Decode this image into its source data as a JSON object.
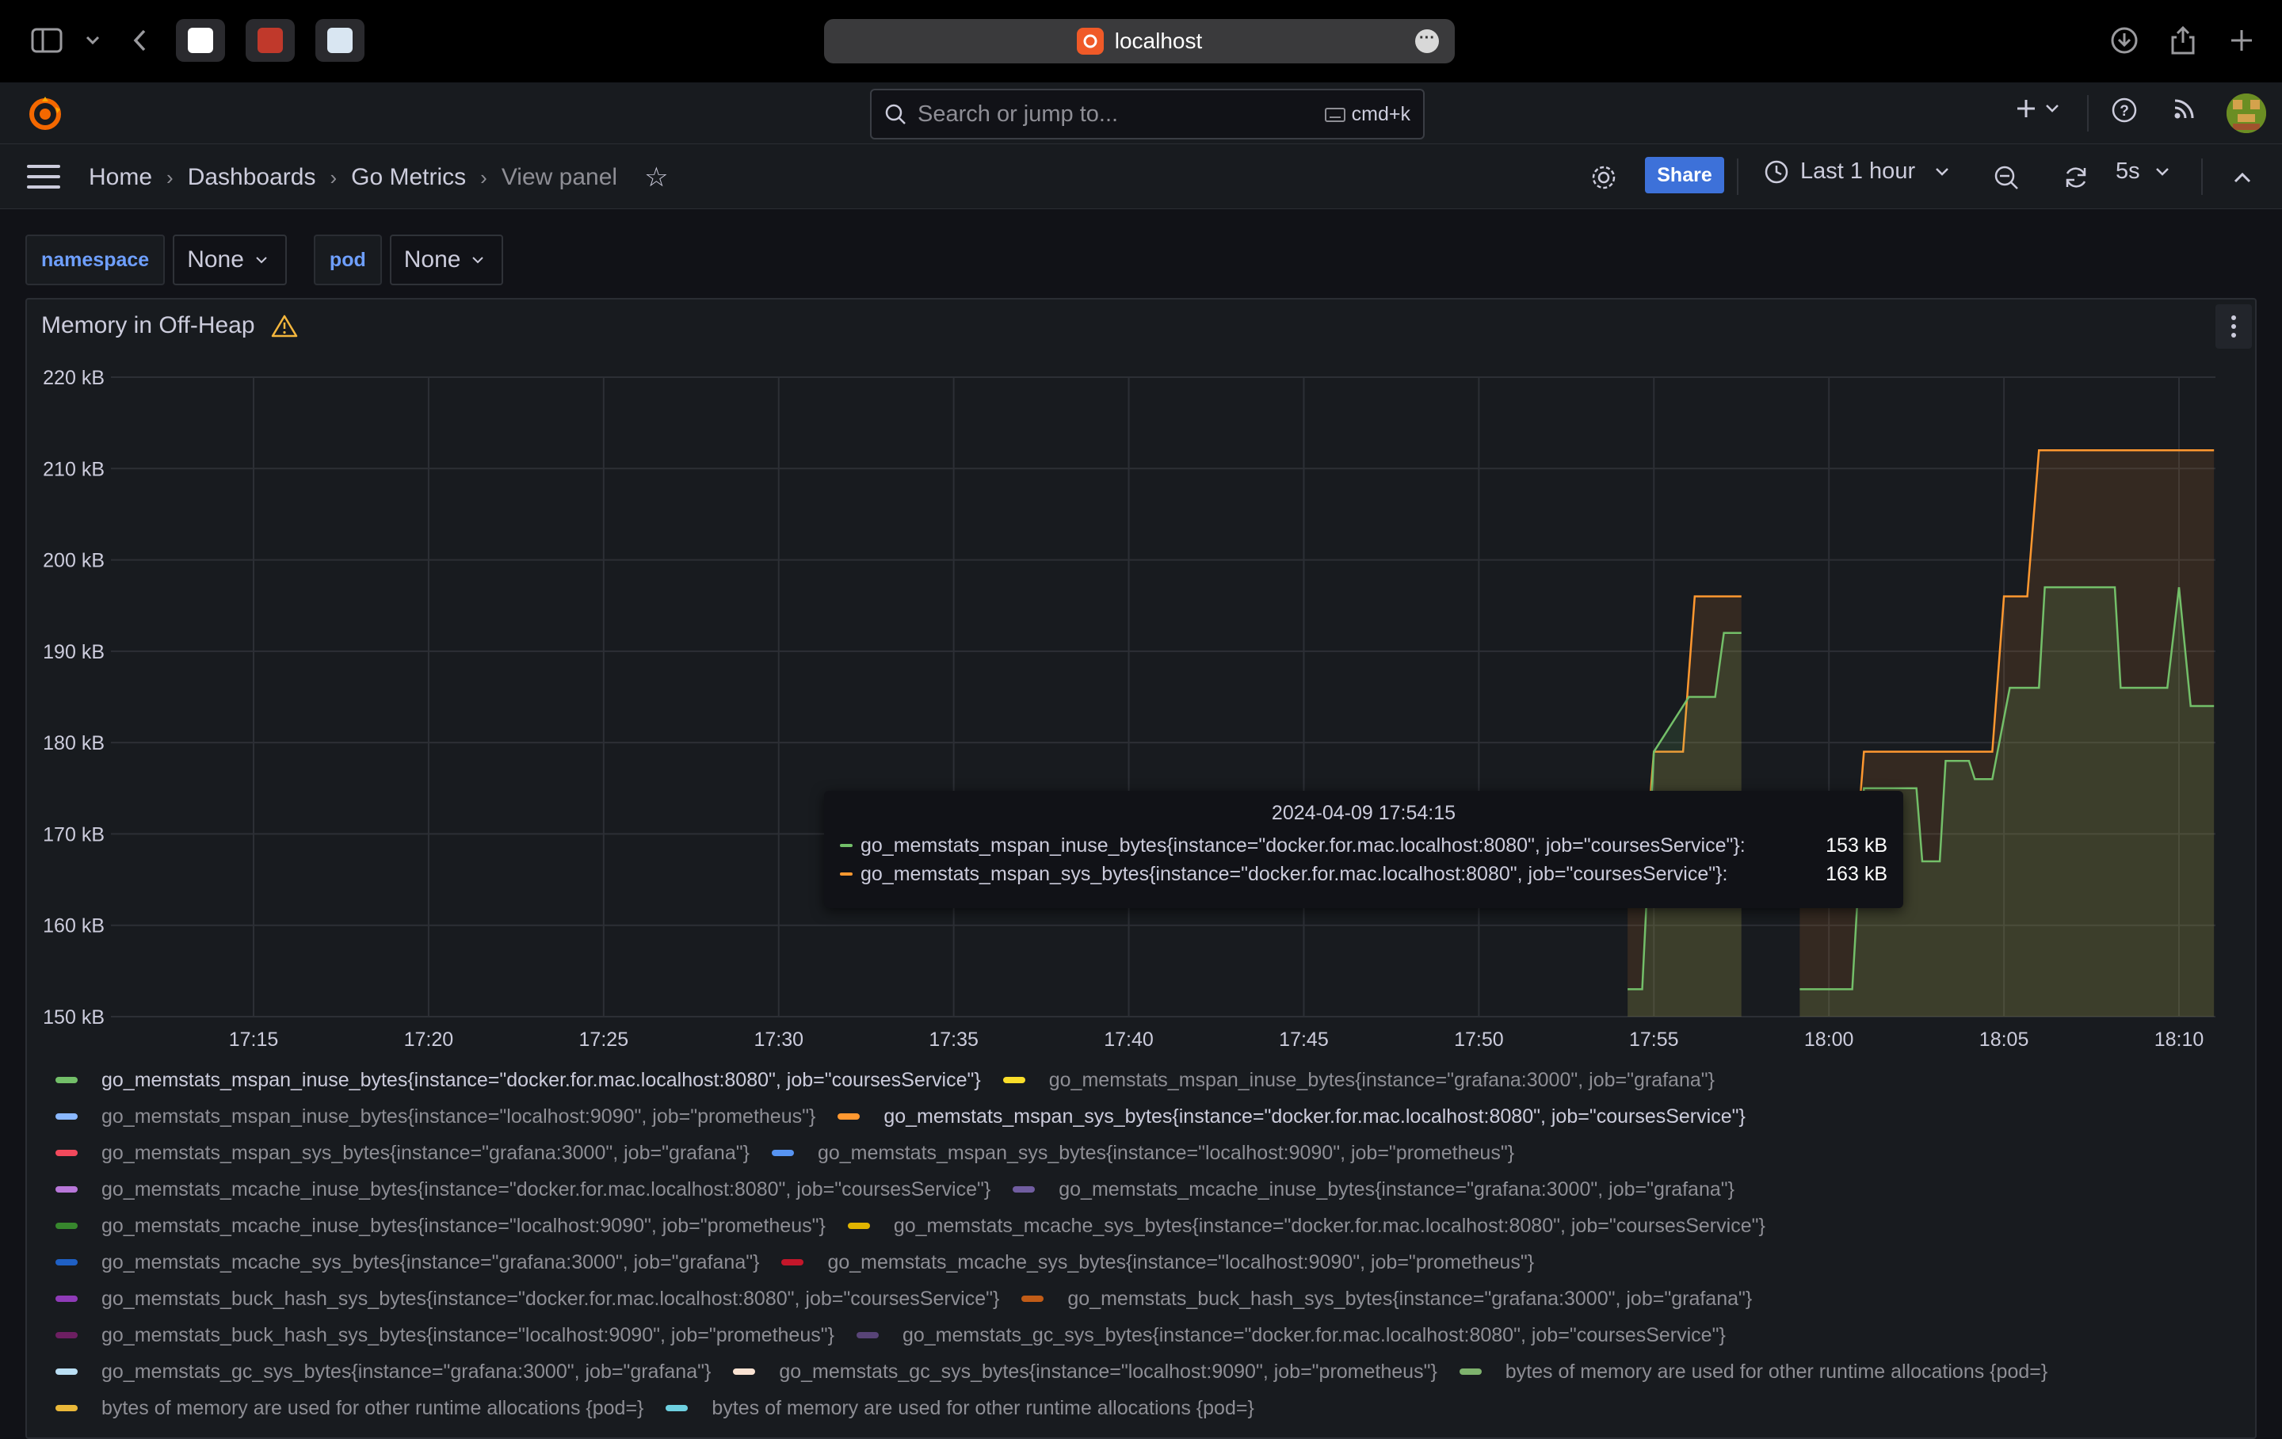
{
  "browser": {
    "url": "localhost"
  },
  "nav": {
    "search_placeholder": "Search or jump to...",
    "shortcut": "cmd+k"
  },
  "breadcrumbs": {
    "home": "Home",
    "dashboards": "Dashboards",
    "dashboard": "Go Metrics",
    "current": "View panel"
  },
  "toolbar": {
    "share": "Share",
    "time_range": "Last 1 hour",
    "refresh_interval": "5s"
  },
  "variables": [
    {
      "label": "namespace",
      "value": "None"
    },
    {
      "label": "pod",
      "value": "None"
    }
  ],
  "panel": {
    "title": "Memory in Off-Heap"
  },
  "chart_data": {
    "type": "line",
    "title": "Memory in Off-Heap",
    "y_ticks": [
      "220 kB",
      "210 kB",
      "200 kB",
      "190 kB",
      "180 kB",
      "170 kB",
      "160 kB",
      "150 kB"
    ],
    "ylim": [
      150,
      220
    ],
    "y_unit": "kB",
    "x_ticks": [
      "17:15",
      "17:20",
      "17:25",
      "17:30",
      "17:35",
      "17:40",
      "17:45",
      "17:50",
      "17:55",
      "18:00",
      "18:05",
      "18:10"
    ],
    "grid": true,
    "series": [
      {
        "name": "go_memstats_mspan_inuse_bytes{instance=\"docker.for.mac.localhost:8080\", job=\"coursesService\"}",
        "color": "#73bf69",
        "segments": [
          [
            [
              "17:54:15",
              153
            ],
            [
              "17:54:40",
              153
            ],
            [
              "17:55:00",
              179
            ],
            [
              "17:56:00",
              185
            ],
            [
              "17:56:45",
              185
            ],
            [
              "17:57:00",
              192
            ],
            [
              "17:57:30",
              192
            ]
          ],
          [
            [
              "17:59:10",
              153
            ],
            [
              "18:00:40",
              153
            ],
            [
              "18:01:00",
              175
            ],
            [
              "18:02:30",
              175
            ],
            [
              "18:02:40",
              167
            ],
            [
              "18:03:10",
              167
            ],
            [
              "18:03:20",
              178
            ],
            [
              "18:04:00",
              178
            ],
            [
              "18:04:10",
              176
            ],
            [
              "18:04:40",
              176
            ],
            [
              "18:05:10",
              186
            ],
            [
              "18:06:00",
              186
            ],
            [
              "18:06:10",
              197
            ],
            [
              "18:08:10",
              197
            ],
            [
              "18:08:20",
              186
            ],
            [
              "18:09:40",
              186
            ],
            [
              "18:10:00",
              197
            ],
            [
              "18:10:20",
              184
            ],
            [
              "18:11:00",
              184
            ]
          ]
        ]
      },
      {
        "name": "go_memstats_mspan_sys_bytes{instance=\"docker.for.mac.localhost:8080\", job=\"coursesService\"}",
        "color": "#ff9830",
        "segments": [
          [
            [
              "17:54:15",
              163
            ],
            [
              "17:54:40",
              163
            ],
            [
              "17:55:00",
              179
            ],
            [
              "17:55:50",
              179
            ],
            [
              "17:56:10",
              196
            ],
            [
              "17:57:30",
              196
            ]
          ],
          [
            [
              "17:59:10",
              163
            ],
            [
              "18:00:40",
              163
            ],
            [
              "18:01:00",
              179
            ],
            [
              "18:04:40",
              179
            ],
            [
              "18:05:00",
              196
            ],
            [
              "18:05:40",
              196
            ],
            [
              "18:06:00",
              212
            ],
            [
              "18:11:00",
              212
            ]
          ]
        ]
      }
    ]
  },
  "tooltip": {
    "time": "2024-04-09 17:54:15",
    "rows": [
      {
        "name": "go_memstats_mspan_inuse_bytes{instance=\"docker.for.mac.localhost:8080\", job=\"coursesService\"}:",
        "value": "153 kB",
        "color": "#73bf69"
      },
      {
        "name": "go_memstats_mspan_sys_bytes{instance=\"docker.for.mac.localhost:8080\", job=\"coursesService\"}:",
        "value": "163 kB",
        "color": "#ff9830"
      }
    ]
  },
  "legend": [
    [
      {
        "label": "go_memstats_mspan_inuse_bytes{instance=\"docker.for.mac.localhost:8080\", job=\"coursesService\"}",
        "color": "#73bf69",
        "active": true
      },
      {
        "label": "go_memstats_mspan_inuse_bytes{instance=\"grafana:3000\", job=\"grafana\"}",
        "color": "#fade2a",
        "active": false
      }
    ],
    [
      {
        "label": "go_memstats_mspan_inuse_bytes{instance=\"localhost:9090\", job=\"prometheus\"}",
        "color": "#8ab8ff",
        "active": false
      },
      {
        "label": "go_memstats_mspan_sys_bytes{instance=\"docker.for.mac.localhost:8080\", job=\"coursesService\"}",
        "color": "#ff9830",
        "active": true
      }
    ],
    [
      {
        "label": "go_memstats_mspan_sys_bytes{instance=\"grafana:3000\", job=\"grafana\"}",
        "color": "#f2495c",
        "active": false
      },
      {
        "label": "go_memstats_mspan_sys_bytes{instance=\"localhost:9090\", job=\"prometheus\"}",
        "color": "#5794f2",
        "active": false
      }
    ],
    [
      {
        "label": "go_memstats_mcache_inuse_bytes{instance=\"docker.for.mac.localhost:8080\", job=\"coursesService\"}",
        "color": "#b877d9",
        "active": false
      },
      {
        "label": "go_memstats_mcache_inuse_bytes{instance=\"grafana:3000\", job=\"grafana\"}",
        "color": "#705da0",
        "active": false
      }
    ],
    [
      {
        "label": "go_memstats_mcache_inuse_bytes{instance=\"localhost:9090\", job=\"prometheus\"}",
        "color": "#37872d",
        "active": false
      },
      {
        "label": "go_memstats_mcache_sys_bytes{instance=\"docker.for.mac.localhost:8080\", job=\"coursesService\"}",
        "color": "#e0b400",
        "active": false
      }
    ],
    [
      {
        "label": "go_memstats_mcache_sys_bytes{instance=\"grafana:3000\", job=\"grafana\"}",
        "color": "#1f60c4",
        "active": false
      },
      {
        "label": "go_memstats_mcache_sys_bytes{instance=\"localhost:9090\", job=\"prometheus\"}",
        "color": "#c4162a",
        "active": false
      }
    ],
    [
      {
        "label": "go_memstats_buck_hash_sys_bytes{instance=\"docker.for.mac.localhost:8080\", job=\"coursesService\"}",
        "color": "#8f3bb8",
        "active": false
      },
      {
        "label": "go_memstats_buck_hash_sys_bytes{instance=\"grafana:3000\", job=\"grafana\"}",
        "color": "#c15c17",
        "active": false
      }
    ],
    [
      {
        "label": "go_memstats_buck_hash_sys_bytes{instance=\"localhost:9090\", job=\"prometheus\"}",
        "color": "#6d1f62",
        "active": false
      },
      {
        "label": "go_memstats_gc_sys_bytes{instance=\"docker.for.mac.localhost:8080\", job=\"coursesService\"}",
        "color": "#584477",
        "active": false
      }
    ],
    [
      {
        "label": "go_memstats_gc_sys_bytes{instance=\"grafana:3000\", job=\"grafana\"}",
        "color": "#badff4",
        "active": false
      },
      {
        "label": "go_memstats_gc_sys_bytes{instance=\"localhost:9090\", job=\"prometheus\"}",
        "color": "#f9e2d2",
        "active": false
      },
      {
        "label": "bytes of memory are used for other runtime allocations {pod=}",
        "color": "#7eb26d",
        "active": false
      }
    ],
    [
      {
        "label": "bytes of memory are used for other runtime allocations {pod=}",
        "color": "#eab839",
        "active": false
      },
      {
        "label": "bytes of memory are used for other runtime allocations {pod=}",
        "color": "#6ed0e0",
        "active": false
      }
    ]
  ]
}
